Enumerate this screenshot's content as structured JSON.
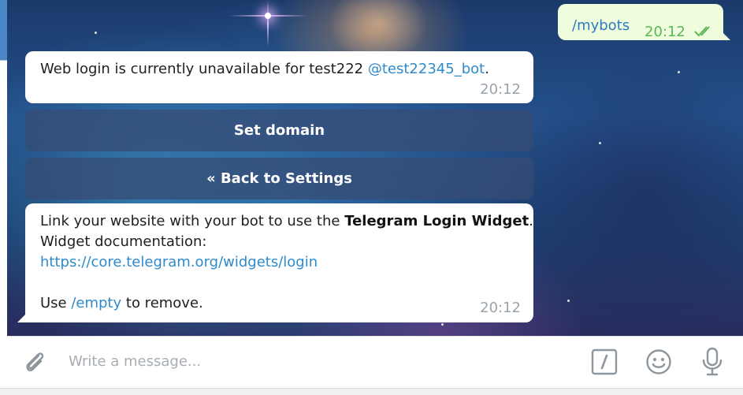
{
  "outgoing": {
    "text": "/mybots",
    "time": "20:12"
  },
  "message1": {
    "text_before": "Web login is currently unavailable for test222 ",
    "mention": "@test22345_bot",
    "text_after": ".",
    "time": "20:12"
  },
  "keyboard": {
    "button1": "Set domain",
    "button2": "« Back to Settings"
  },
  "message2": {
    "line1_before": "Link your website with your bot to use the ",
    "line1_bold": "Telegram Login Widget",
    "line1_after": ".",
    "line2": "Widget documentation:",
    "link": "https://core.telegram.org/widgets/login",
    "line4_before": "Use ",
    "line4_cmd": "/empty",
    "line4_after": " to remove.",
    "time": "20:12"
  },
  "composer": {
    "placeholder": "Write a message..."
  },
  "icons": [
    "attach-icon",
    "bot-command-icon",
    "emoji-icon",
    "microphone-icon",
    "double-check-icon"
  ],
  "colors": {
    "outgoing_bubble": "#effdde",
    "link": "#2f8acb",
    "read_check": "#5db656",
    "keyboard_button": "#374b73"
  }
}
